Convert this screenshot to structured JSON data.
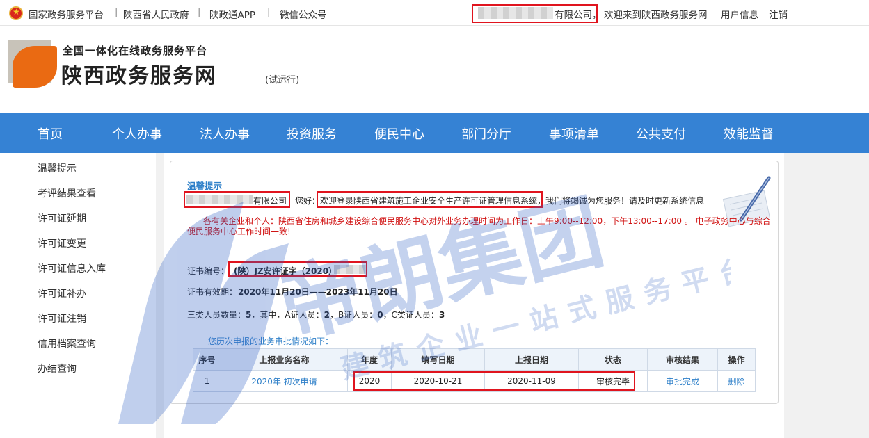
{
  "topbar": {
    "links": [
      "国家政务服务平台",
      "陕西省人民政府",
      "陕政通APP",
      "微信公众号"
    ],
    "separator": "|",
    "company_suffix": "有限公司，",
    "welcome": "欢迎来到陕西政务服务网",
    "user_info": "用户信息",
    "logout": "注销"
  },
  "header": {
    "subtitle": "全国一体化在线政务服务平台",
    "title": "陕西政务服务网",
    "trial": "(试运行)"
  },
  "nav": [
    "首页",
    "个人办事",
    "法人办事",
    "投资服务",
    "便民中心",
    "部门分厅",
    "事项清单",
    "公共支付",
    "效能监督"
  ],
  "sidebar": [
    "温馨提示",
    "考评结果查看",
    "许可证延期",
    "许可证变更",
    "许可证信息入库",
    "许可证补办",
    "许可证注销",
    "信用档案查询",
    "办结查询"
  ],
  "notice": {
    "title": "温馨提示",
    "company_suffix": "有限公司",
    "greeting": "您好：",
    "welcome": "欢迎登录陕西省建筑施工企业安全生产许可证管理信息系统，",
    "service": "我们将竭诚为您服务！请及时更新系统信息",
    "hours_line1": "各有关企业和个人：陕西省住房和城乡建设综合便民服务中心对外业务办理时间为工作日：上午9:00--12:00，下午13:00--17:00 。 电子政务中心与综合",
    "hours_line2": "便民服务中心工作时间一致!"
  },
  "certificate": {
    "number_label": "证书编号：",
    "number_value": "(陕）JZ安许证字（2020）",
    "validity_label": "证书有效期：",
    "validity_value": "2020年11月20日——2023年11月20日",
    "staff_label": "三类人员数量：",
    "staff_total": "5",
    "staff_mid": "，其中，A证人员：",
    "staff_a": "2",
    "staff_b_label": "，B证人员：",
    "staff_b": "0",
    "staff_c_label": "，C类证人员：",
    "staff_c": "3"
  },
  "history": {
    "caption": "您历次申报的业务审批情况如下：",
    "headers": [
      "序号",
      "上报业务名称",
      "年度",
      "填写日期",
      "上报日期",
      "状态",
      "审核结果",
      "操作"
    ],
    "rows": [
      [
        "1",
        "2020年 初次申请",
        "2020",
        "2020-10-21",
        "2020-11-09",
        "审核完毕",
        "审批完成",
        "删除"
      ]
    ]
  },
  "watermark": {
    "main": "帝朗集团",
    "sub": "建筑企业一站式服务平台"
  },
  "colors": {
    "nav_blue": "#3582d4",
    "link_blue": "#2f80c9",
    "highlight_red": "#e0141e",
    "notice_red": "#d01010"
  }
}
